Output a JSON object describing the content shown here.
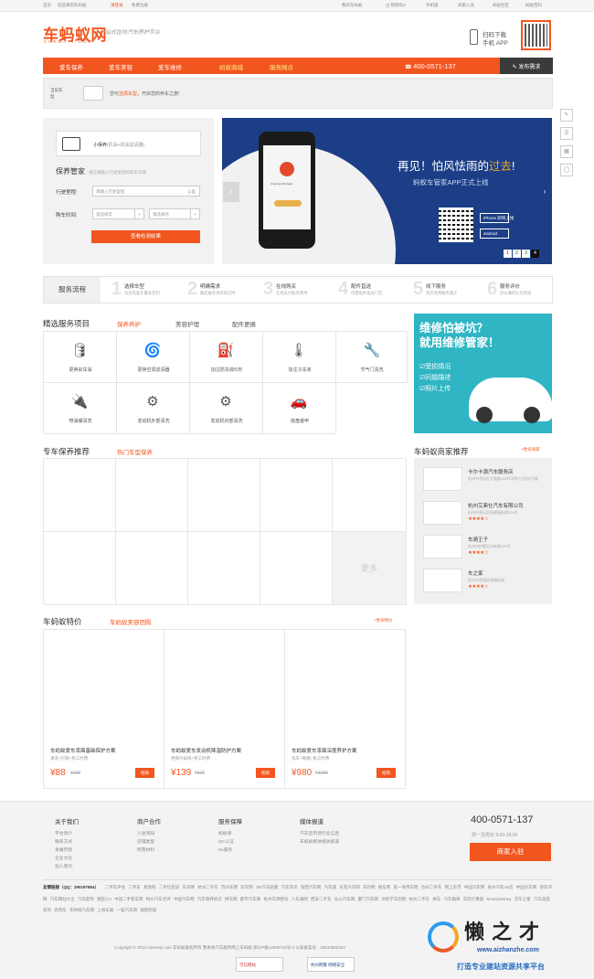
{
  "topbar": {
    "left": [
      "首页",
      "欢迎来到车蚂蚁",
      "请登录",
      "免费注册"
    ],
    "right": [
      "我的车蚂蚁",
      "购物车",
      "0",
      "手机版",
      "商家入驻",
      "蚂蚁社区",
      "蚂蚁百科"
    ]
  },
  "header": {
    "logo": "车蚂蚁网",
    "logo_sub": "CHEMAYI.COM",
    "slogan": "一站式在线汽车养护平台",
    "download_line1": "扫码下载",
    "download_line2": "手机 APP"
  },
  "nav": {
    "items": [
      "爱车保养",
      "爱车美容",
      "爱车维修",
      "蚂蚁商城",
      "服务网点"
    ],
    "hotline": "400-0571-137",
    "publish": "发布需求"
  },
  "carbar": {
    "label": "当前车型",
    "msg_pre": "您可",
    "msg_link": "选择车型",
    "msg_post": "，开启您的养车之旅!"
  },
  "maintenance": {
    "package": "小保养",
    "package_note": "(机油+机油滤清器)",
    "title": "保养管家",
    "hint": "请正确输入行驶里程和购车日期",
    "mileage_label": "行驶里程:",
    "mileage_placeholder": "请输入行驶里程",
    "mileage_unit": "公里",
    "date_label": "购车时间:",
    "year": "请选择年",
    "month": "请选择月",
    "button": "查看检测结果"
  },
  "banner": {
    "headline_pre": "再见！怕风怯雨的",
    "headline_hl": "过去",
    "headline_post": "!",
    "subline": "蚂蚁车管家APP正式上线",
    "app_name": "Chemayi Manager",
    "store1": "iPhone 即将上线",
    "store2": "android",
    "pages": [
      "1",
      "2",
      "3",
      "4"
    ],
    "active_page": "4"
  },
  "sidebar_tools": [
    "✎",
    "☰",
    "▦",
    "◯"
  ],
  "flow": {
    "label": "服务流程",
    "steps": [
      {
        "n": "1",
        "a": "选择车型",
        "b": "为您的爱车量身定制"
      },
      {
        "n": "2",
        "a": "明确需求",
        "b": "确定服务项目和订时"
      },
      {
        "n": "3",
        "a": "在线购买",
        "b": "在线支付服务费用"
      },
      {
        "n": "4",
        "a": "配件直送",
        "b": "所需配件直送门店"
      },
      {
        "n": "5",
        "a": "线下服务",
        "b": "到店免费服务施工"
      },
      {
        "n": "6",
        "a": "服务评价",
        "b": "评价赚积分兑奖励"
      }
    ]
  },
  "services": {
    "title": "精选服务项目",
    "tabs": [
      "保养养护",
      "美容护理",
      "配件更换"
    ],
    "items": [
      "更换刹车油",
      "更换空调滤清器",
      "加注防冻液/5剂",
      "加注冷冻液",
      "节气门清洗",
      "喷油嘴清洗",
      "发动机外部清洗",
      "发动机内部清洗",
      "底盘装甲"
    ]
  },
  "ad": {
    "headline1": "维修怕被坑？",
    "headline2": "就用维修管家！",
    "points": [
      "受损情况",
      "问题描述",
      "照片上传"
    ]
  },
  "recommend": {
    "title": "专车保养推荐",
    "tab": "热门车型保养",
    "more": "更多"
  },
  "merchants": {
    "title": "车蚂蚁商家推荐",
    "more": "+更多商家",
    "list": [
      {
        "name": "卡尔卡源汽车服务店",
        "desc": "杭州市余杭区兴盛路158号河畔产业园1号楼",
        "stars": ""
      },
      {
        "name": "杭州艾弗仕汽车有限公司",
        "desc": "杭州市萧山区新塘镇街道138号",
        "stars": "★★★★☆"
      },
      {
        "name": "车骑王子",
        "desc": "杭州市拱墅区东新路169号",
        "stars": "★★★★☆"
      },
      {
        "name": "车之家",
        "desc": "杭州市西湖区转塘街道",
        "stars": "★★★★☆"
      }
    ]
  },
  "deals": {
    "title": "车蚂蚁特价",
    "tab": "车蚂蚁美容团购",
    "more": "+更多特价",
    "items": [
      {
        "name": "车蚂蚁爱车漆面基础保护方案",
        "sub": "清洗+打蜡+免工时费",
        "price": "¥88",
        "old": "¥120",
        "btn": "抢购"
      },
      {
        "name": "车蚂蚁爱车发动机降温防护方案",
        "sub": "更换冷却液+免工时费",
        "price": "¥139",
        "old": "¥320",
        "btn": "抢购"
      },
      {
        "name": "车蚂蚁爱车漆面深度养护方案",
        "sub": "洗车+镀膜+免工时费",
        "price": "¥980",
        "old": "¥1280",
        "btn": "抢购"
      }
    ]
  },
  "footer": {
    "cols": [
      {
        "title": "关于我们",
        "links": [
          "平台简介",
          "联系方式",
          "发展历程",
          "企业文化",
          "加入我们"
        ]
      },
      {
        "title": "商户合作",
        "links": [
          "入驻须知",
          "店铺类型",
          "所需材料"
        ]
      },
      {
        "title": "服务保障",
        "links": [
          "蚂蚁保",
          "QC认证",
          "5A服务"
        ]
      },
      {
        "title": "媒体报道",
        "links": [
          "汽车后市场行业信息",
          "车蚂蚁媒体相关报道"
        ]
      }
    ],
    "phone": "400-0571-137",
    "hours": "周一至周日   9:00-18:00",
    "join": "商家入驻",
    "links_label": "友情链接（QQ：290197854）",
    "links": "二手车评估  二手车  爱驰购  二手比亚迪  车讯网  杭州二手车  苏州车网  玩车网  3M汽车贴膜  汽车资讯  淘西汽车网  汽车城  东莞汽车网  车险网  搜车吧  第一商用车网  台州二手车  网上车市  中国汽车网  泉州汽车4S店  中国买车网  新车评网  汽车网站大全  汽车配件  期区CU  中国二手客车网  杭州汽车点评  中国汽车网  汽车保养知识  拼车网  都市汽车网  杭州车牌摇号  八车通网  西安二手车  乐山汽车网  厦门汽车网  深圳学车团购  杭州二手车  拼车  汽车轴章  车险计算器  MoneyMoney  货车之家  汽车美容  装饰  商用车  年终榜汽车网  上海车展  一猫汽车网  瑞昭控股",
    "copyright": "Copyright © 2012 chemayi.com 车蚂蚁版权所有     我本地汽车服务网上车蚂蚁     浙ICP备12006742号-2     公安备案号：33010602004",
    "badge1": "可信网站",
    "badge2": "杭州网警  网络安全"
  },
  "watermark": {
    "big": "懒之才",
    "url": "www.aizhanzhe.com",
    "tag": "打造专业建站资源共享平台"
  },
  "colors": {
    "accent": "#f2561f",
    "banner": "#1b3e86",
    "ad": "#2fb5c4"
  }
}
